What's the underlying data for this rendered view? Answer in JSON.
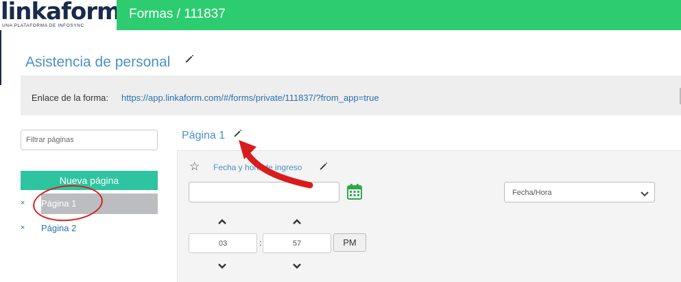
{
  "header": {
    "logo_text": "linkaform",
    "logo_tagline": "UNA PLATAFORMA DE INFOSYNC",
    "breadcrumb": "Formas / 111837",
    "bar_color": "#2ecc71"
  },
  "form": {
    "title": "Asistencia de personal",
    "link_label": "Enlace de la forma:",
    "link_url": "https://app.linkaform.com/#/forms/private/111837/?from_app=true"
  },
  "sidebar": {
    "filter_placeholder": "Filtrar páginas",
    "new_page_label": "Nueva página",
    "remove_icon": "×",
    "pages": [
      {
        "label": "Página 1",
        "active": true
      },
      {
        "label": "Página 2",
        "active": false
      }
    ]
  },
  "page": {
    "title": "Página 1",
    "field": {
      "star_icon": "☆",
      "label": "Fecha y hora de ingreso",
      "type_options_selected": "Fecha/Hora",
      "time": {
        "hour": "03",
        "minute": "57",
        "separator": ":",
        "period": "PM"
      }
    }
  },
  "colors": {
    "accent": "#4a90c8",
    "link": "#2a6fb0",
    "new_page_button": "#2ec4a0",
    "annotation": "#d91c1c"
  }
}
